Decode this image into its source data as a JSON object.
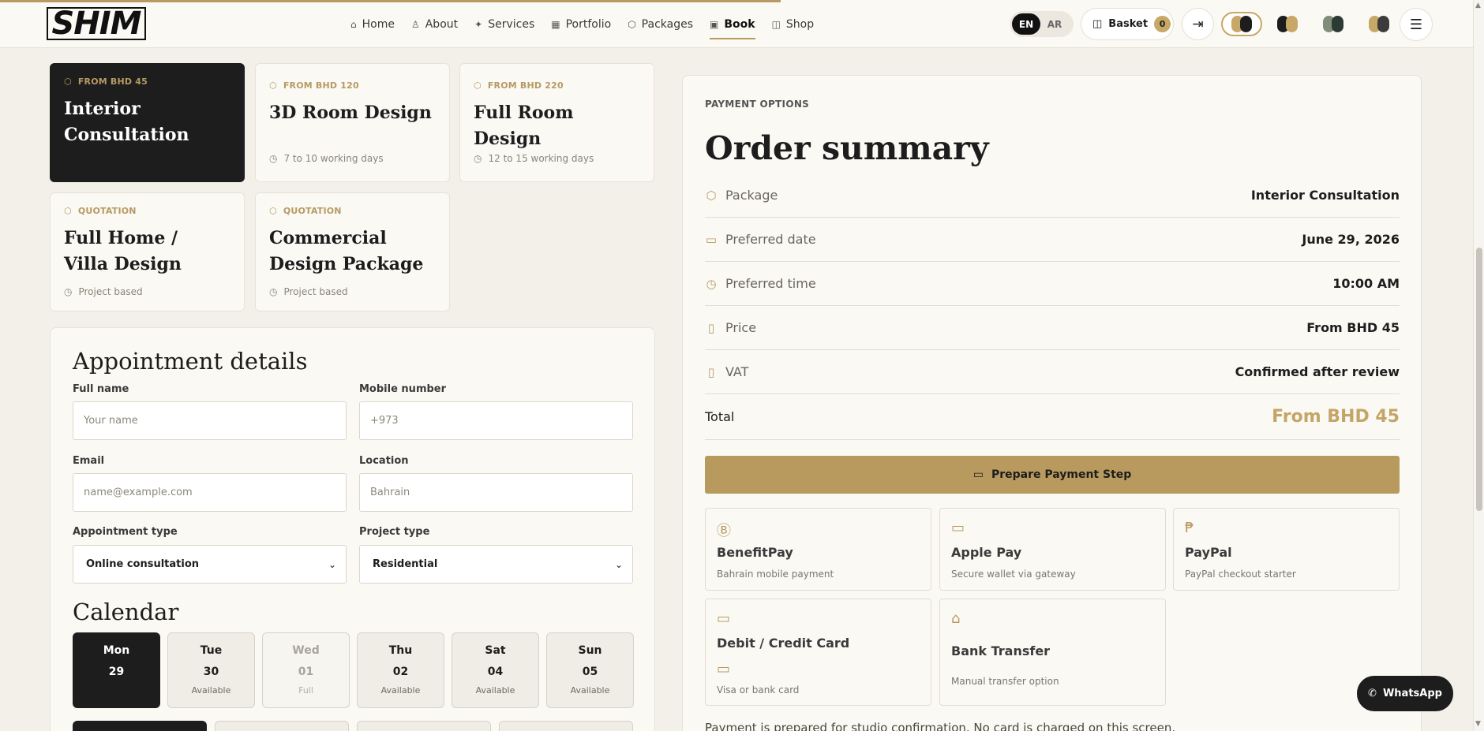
{
  "brand": {
    "logo_text": "SHIM"
  },
  "page_load_progress": 0.53,
  "nav": {
    "items": [
      {
        "label": "Home",
        "icon": "home-icon",
        "glyph": "⌂"
      },
      {
        "label": "About",
        "icon": "user-icon",
        "glyph": "♙"
      },
      {
        "label": "Services",
        "icon": "sparkle-icon",
        "glyph": "✦"
      },
      {
        "label": "Portfolio",
        "icon": "grid-icon",
        "glyph": "▦"
      },
      {
        "label": "Packages",
        "icon": "package-icon",
        "glyph": "⬡"
      },
      {
        "label": "Book",
        "icon": "calendar-icon",
        "glyph": "▣"
      },
      {
        "label": "Shop",
        "icon": "bag-icon",
        "glyph": "◫"
      }
    ],
    "active": "Book"
  },
  "header": {
    "lang_en": "EN",
    "lang_ar": "AR",
    "basket_label": "Basket",
    "basket_count": "0"
  },
  "theme_swatches": [
    {
      "a": "#c7a867",
      "b": "#1d1d1d",
      "selected": true
    },
    {
      "a": "#1d1d1d",
      "b": "#c7a867",
      "selected": false
    },
    {
      "a": "#7f8d7a",
      "b": "#2b3a33",
      "selected": false
    },
    {
      "a": "#c7a867",
      "b": "#3b3b3b",
      "selected": false
    }
  ],
  "packages": [
    {
      "tag": "FROM BHD 45",
      "name": "Interior Consultation",
      "meta": "",
      "selected": true
    },
    {
      "tag": "FROM BHD 120",
      "name": "3D Room Design",
      "meta": "7 to 10 working days",
      "selected": false
    },
    {
      "tag": "FROM BHD 220",
      "name": "Full Room Design",
      "meta": "12 to 15 working days",
      "selected": false
    },
    {
      "tag": "QUOTATION",
      "name": "Full Home / Villa Design",
      "meta": "Project based",
      "selected": false
    },
    {
      "tag": "QUOTATION",
      "name": "Commercial Design Package",
      "meta": "Project based",
      "selected": false
    }
  ],
  "appointment": {
    "title": "Appointment details",
    "full_name_label": "Full name",
    "full_name_placeholder": "Your name",
    "mobile_label": "Mobile number",
    "mobile_placeholder": "+973",
    "email_label": "Email",
    "email_placeholder": "name@example.com",
    "location_label": "Location",
    "location_placeholder": "Bahrain",
    "appt_type_label": "Appointment type",
    "appt_type_value": "Online consultation",
    "project_type_label": "Project type",
    "project_type_value": "Residential",
    "calendar_title": "Calendar",
    "days": [
      {
        "name": "Mon",
        "date": "29",
        "status": "",
        "state": "selected"
      },
      {
        "name": "Tue",
        "date": "30",
        "status": "Available",
        "state": "available"
      },
      {
        "name": "Wed",
        "date": "01",
        "status": "Full",
        "state": "full"
      },
      {
        "name": "Thu",
        "date": "02",
        "status": "Available",
        "state": "available"
      },
      {
        "name": "Sat",
        "date": "04",
        "status": "Available",
        "state": "available"
      },
      {
        "name": "Sun",
        "date": "05",
        "status": "Available",
        "state": "available"
      }
    ]
  },
  "summary": {
    "eyebrow": "PAYMENT OPTIONS",
    "title": "Order summary",
    "rows": [
      {
        "label": "Package",
        "value": "Interior Consultation",
        "icon": "package-icon",
        "glyph": "⬡"
      },
      {
        "label": "Preferred date",
        "value": "June 29, 2026",
        "icon": "calendar-icon",
        "glyph": "▭"
      },
      {
        "label": "Preferred time",
        "value": "10:00 AM",
        "icon": "clock-icon",
        "glyph": "◷"
      },
      {
        "label": "Price",
        "value": "From BHD 45",
        "icon": "receipt-icon",
        "glyph": "▯"
      },
      {
        "label": "VAT",
        "value": "Confirmed after review",
        "icon": "document-icon",
        "glyph": "▯"
      }
    ],
    "total_label": "Total",
    "total_value": "From BHD 45",
    "pay_button": "Prepare Payment Step",
    "methods": [
      {
        "name": "BenefitPay",
        "desc": "Bahrain mobile payment",
        "icon": "benefitpay-icon",
        "glyph": "Ⓑ"
      },
      {
        "name": "Apple Pay",
        "desc": "Secure wallet via gateway",
        "icon": "wallet-icon",
        "glyph": "▭"
      },
      {
        "name": "PayPal",
        "desc": "PayPal checkout starter",
        "icon": "paypal-icon",
        "glyph": "₱"
      },
      {
        "name": "Debit / Credit Card",
        "desc": "Visa or bank card",
        "icon": "card-icon",
        "glyph": "▭"
      },
      {
        "name": "Bank Transfer",
        "desc": "Manual transfer option",
        "icon": "bank-icon",
        "glyph": "⌂"
      }
    ],
    "note": "Payment is prepared for studio confirmation. No card is charged on this screen."
  },
  "whatsapp_label": "WhatsApp",
  "colors": {
    "accent": "#b79a63",
    "dark": "#1d1d1d",
    "background": "#f3f0ea",
    "panel": "#fbf9f4"
  }
}
